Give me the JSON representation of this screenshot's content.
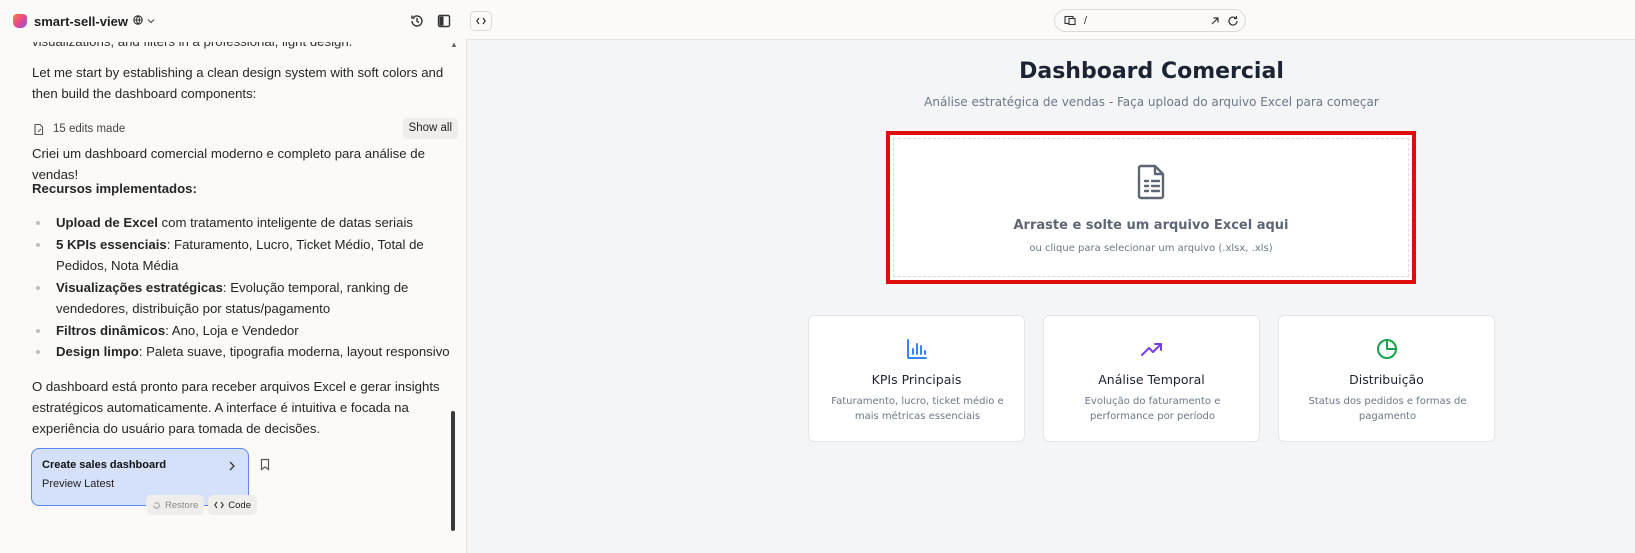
{
  "project": {
    "name": "smart-sell-view"
  },
  "chat": {
    "cut_line": "visualizations, and filters in a professional, light design.",
    "intro": "Let me start by establishing a clean design system with soft colors and then build the dashboard components:",
    "edits_label": "15 edits made",
    "show_all": "Show all",
    "summary": "Criei um dashboard comercial moderno e completo para análise de vendas!",
    "features_heading": "Recursos implementados:",
    "features": [
      {
        "bold": "Upload de Excel",
        "rest": " com tratamento inteligente de datas seriais"
      },
      {
        "bold": "5 KPIs essenciais",
        "rest": ": Faturamento, Lucro, Ticket Médio, Total de Pedidos, Nota Média"
      },
      {
        "bold": "Visualizações estratégicas",
        "rest": ": Evolução temporal, ranking de vendedores, distribuição por status/pagamento"
      },
      {
        "bold": "Filtros dinâmicos",
        "rest": ": Ano, Loja e Vendedor"
      },
      {
        "bold": "Design limpo",
        "rest": ": Paleta suave, tipografia moderna, layout responsivo"
      }
    ],
    "closing": "O dashboard está pronto para receber arquivos Excel e gerar insights estratégicos automaticamente. A interface é intuitiva e focada na experiência do usuário para tomada de decisões.",
    "version_card": {
      "title": "Create sales dashboard",
      "subtitle": "Preview Latest"
    },
    "restore_label": "Restore",
    "code_label": "Code"
  },
  "browser": {
    "path": "/"
  },
  "dashboard": {
    "title": "Dashboard Comercial",
    "subtitle": "Análise estratégica de vendas - Faça upload do arquivo Excel para começar",
    "drop_title": "Arraste e solte um arquivo Excel aqui",
    "drop_subtitle": "ou clique para selecionar um arquivo (.xlsx, .xls)",
    "features": [
      {
        "title": "KPIs Principais",
        "desc": "Faturamento, lucro, ticket médio e mais métricas essenciais",
        "color": "#3b82f6",
        "icon": "bar-chart-icon"
      },
      {
        "title": "Análise Temporal",
        "desc": "Evolução do faturamento e performance por período",
        "color": "#7c3aed",
        "icon": "trending-up-icon"
      },
      {
        "title": "Distribuição",
        "desc": "Status dos pedidos e formas de pagamento",
        "color": "#16a34a",
        "icon": "pie-chart-icon"
      }
    ]
  },
  "colors": {
    "highlight_border": "#e00d0d",
    "version_card_bg": "#d5e0fb"
  }
}
